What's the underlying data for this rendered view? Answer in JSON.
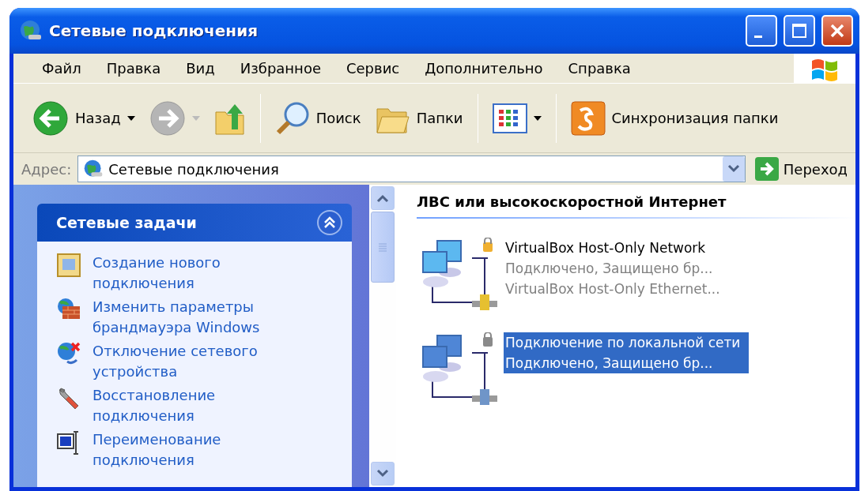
{
  "window": {
    "title": "Сетевые подключения"
  },
  "menu": [
    "Файл",
    "Правка",
    "Вид",
    "Избранное",
    "Сервис",
    "Дополнительно",
    "Справка"
  ],
  "toolbar": [
    {
      "kind": "back",
      "label": "Назад",
      "disabled": false
    },
    {
      "kind": "forward",
      "disabled": true
    },
    {
      "kind": "up"
    },
    {
      "kind": "sep"
    },
    {
      "kind": "search",
      "label": "Поиск"
    },
    {
      "kind": "folders",
      "label": "Папки"
    },
    {
      "kind": "sep"
    },
    {
      "kind": "views"
    },
    {
      "kind": "sep"
    },
    {
      "kind": "sync",
      "label": "Синхронизация папки"
    }
  ],
  "address": {
    "label": "Адрес:",
    "value": "Сетевые подключения",
    "go": "Переход"
  },
  "tasks": {
    "title": "Сетевые задачи",
    "expanded": true,
    "items": [
      {
        "kind": "new",
        "label": "Создание нового подключения"
      },
      {
        "kind": "firewall",
        "label": "Изменить параметры брандмауэра Windows"
      },
      {
        "kind": "disable",
        "label": "Отключение сетевого устройства"
      },
      {
        "kind": "repair",
        "label": "Восстановление подключения"
      },
      {
        "kind": "rename",
        "label": "Переименование подключения"
      }
    ]
  },
  "group": {
    "title": "ЛВС или высокоскоростной Интернет"
  },
  "connections": [
    {
      "name": "VirtualBox Host-Only Network",
      "status": "Подключено, Защищено бр...",
      "device": "VirtualBox Host-Only Ethernet...",
      "selected": false
    },
    {
      "name": "Подключение по локальной сети",
      "status": "Подключено, Защищено бр...",
      "selected": true
    }
  ]
}
